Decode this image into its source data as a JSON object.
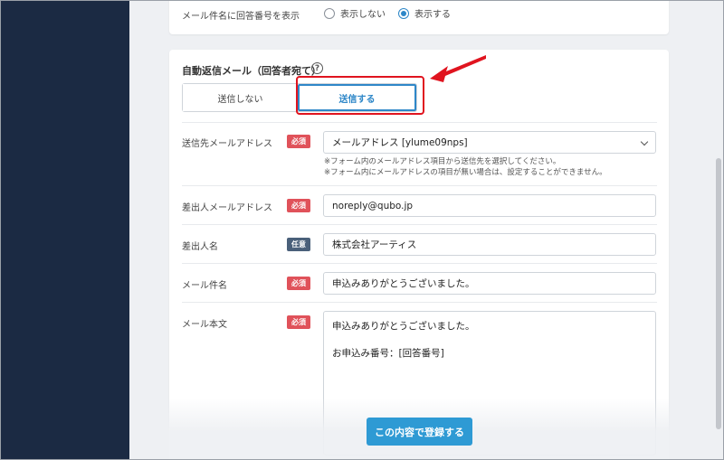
{
  "subject_number": {
    "label": "メール件名に回答番号を表示",
    "options": [
      "表示しない",
      "表示する"
    ],
    "selected": "表示する"
  },
  "auto_reply": {
    "title": "自動返信メール（回答者宛て）",
    "help_icon": "?",
    "toggle_off": "送信しない",
    "toggle_on": "送信する"
  },
  "fields": {
    "recipient": {
      "label": "送信先メールアドレス",
      "badge": "必須",
      "value": "メールアドレス [ylume09nps]",
      "note1": "※フォーム内のメールアドレス項目から送信先を選択してください。",
      "note2": "※フォーム内にメールアドレスの項目が無い場合は、設定することができません。"
    },
    "sender_address": {
      "label": "差出人メールアドレス",
      "badge": "必須",
      "value": "noreply@qubo.jp"
    },
    "sender_name": {
      "label": "差出人名",
      "badge": "任意",
      "value": "株式会社アーティス"
    },
    "subject": {
      "label": "メール件名",
      "badge": "必須",
      "value": "申込みありがとうございました。"
    },
    "body": {
      "label": "メール本文",
      "badge": "必須",
      "line1": "申込みありがとうございました。",
      "line2": "お申込み番号：[回答番号]"
    }
  },
  "submit_label": "この内容で登録する",
  "colors": {
    "sidebar": "#1b2a43",
    "accent": "#2e87c8",
    "required": "#e0525a",
    "optional": "#4a607a",
    "highlight": "#e0141f"
  }
}
